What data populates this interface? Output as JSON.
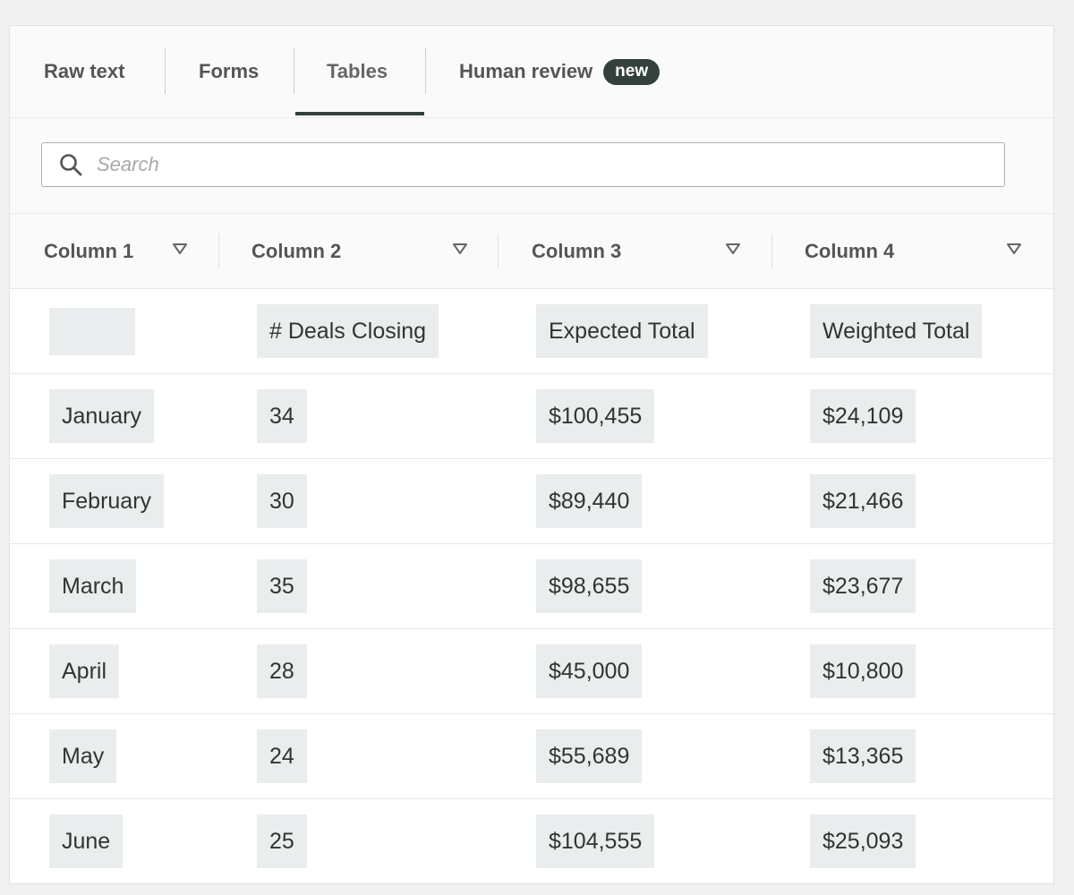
{
  "tabs": [
    {
      "label": "Raw text"
    },
    {
      "label": "Forms"
    },
    {
      "label": "Tables"
    },
    {
      "label": "Human review",
      "badge": "new"
    }
  ],
  "active_tab": "Tables",
  "search": {
    "placeholder": "Search",
    "value": ""
  },
  "table": {
    "columns": [
      "Column 1",
      "Column 2",
      "Column 3",
      "Column 4"
    ],
    "rows": [
      [
        "",
        "# Deals Closing",
        "Expected Total",
        "Weighted Total"
      ],
      [
        "January",
        "34",
        "$100,455",
        "$24,109"
      ],
      [
        "February",
        "30",
        "$89,440",
        "$21,466"
      ],
      [
        "March",
        "35",
        "$98,655",
        "$23,677"
      ],
      [
        "April",
        "28",
        "$45,000",
        "$10,800"
      ],
      [
        "May",
        "24",
        "$55,689",
        "$13,365"
      ],
      [
        "June",
        "25",
        "$104,555",
        "$25,093"
      ]
    ]
  },
  "colors": {
    "accent": "#33413a",
    "chip_bg": "#eaeded",
    "panel_bg": "#fafafa"
  }
}
